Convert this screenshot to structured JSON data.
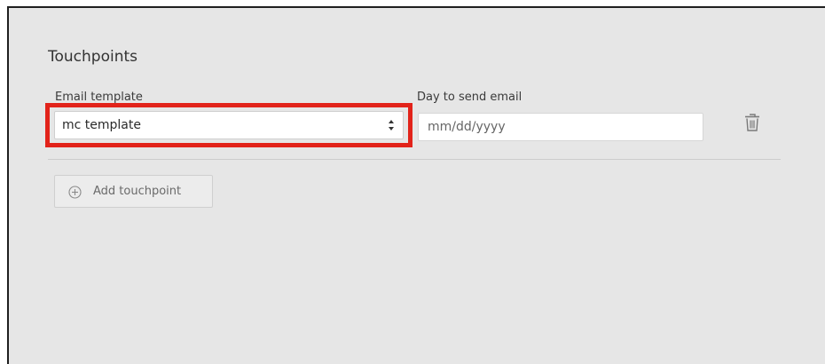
{
  "section": {
    "title": "Touchpoints"
  },
  "touchpoint": {
    "template_label": "Email template",
    "template_value": "mc template",
    "day_label": "Day to send email",
    "day_placeholder": "mm/dd/yyyy",
    "delete_icon": "trash-icon",
    "select_icon": "select-arrows-icon"
  },
  "actions": {
    "add_label": "Add touchpoint",
    "add_icon": "plus-circle-icon"
  },
  "colors": {
    "highlight": "#e2231a",
    "panel_background": "#e6e6e6"
  }
}
